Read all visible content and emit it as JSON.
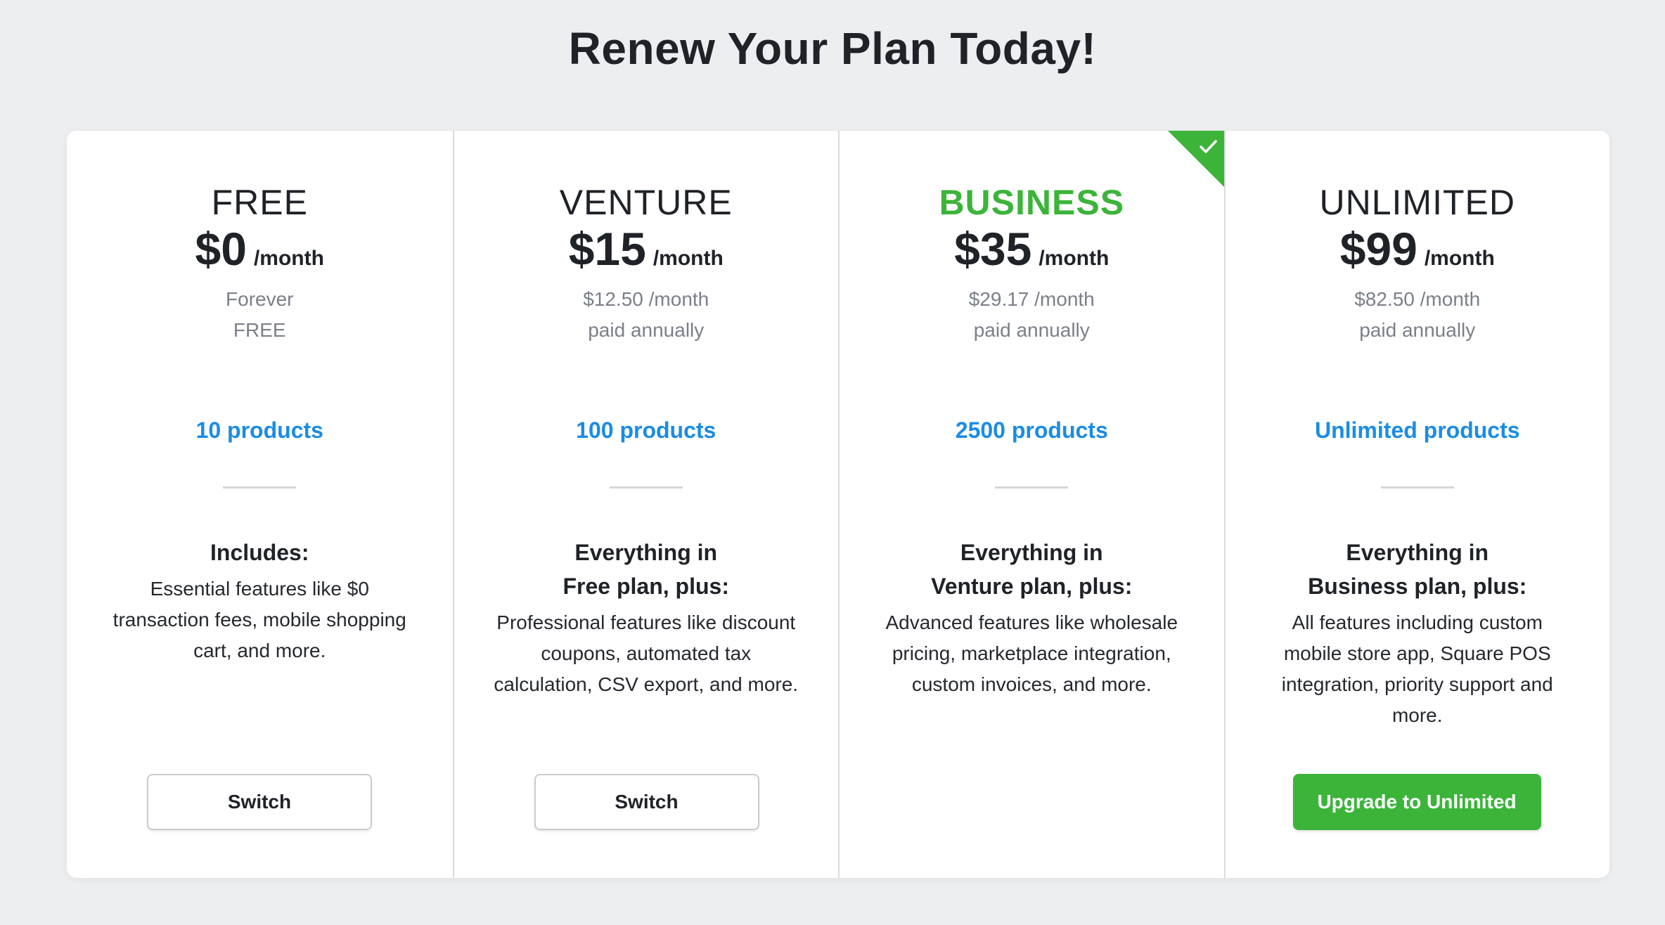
{
  "page": {
    "title": "Renew Your Plan Today!"
  },
  "colors": {
    "accent_green": "#3cb43a",
    "link_blue": "#1a8ce6",
    "muted_text": "#7b8088"
  },
  "plans": [
    {
      "name": "FREE",
      "price": "$0",
      "per": "/month",
      "sub_line1": "Forever",
      "sub_line2": "FREE",
      "products": "10 products",
      "heading_line1": "Includes:",
      "heading_line2": "",
      "description": [
        "Essential features like $0",
        "transaction fees, mobile shopping",
        "cart, and more."
      ],
      "button_label": "Switch"
    },
    {
      "name": "VENTURE",
      "price": "$15",
      "per": "/month",
      "sub_line1": "$12.50 /month",
      "sub_line2": "paid annually",
      "products": "100 products",
      "heading_line1": "Everything in",
      "heading_line2": "Free plan, plus:",
      "description": [
        "Professional features like discount",
        "coupons, automated tax",
        "calculation, CSV export, and more."
      ],
      "button_label": "Switch"
    },
    {
      "name": "BUSINESS",
      "price": "$35",
      "per": "/month",
      "sub_line1": "$29.17 /month",
      "sub_line2": "paid annually",
      "products": "2500 products",
      "heading_line1": "Everything in",
      "heading_line2": "Venture plan, plus:",
      "description": [
        "Advanced features like wholesale",
        "pricing, marketplace integration,",
        "custom invoices, and more."
      ],
      "current_plan_icon": "check-icon"
    },
    {
      "name": "UNLIMITED",
      "price": "$99",
      "per": "/month",
      "sub_line1": "$82.50 /month",
      "sub_line2": "paid annually",
      "products": "Unlimited products",
      "heading_line1": "Everything in",
      "heading_line2": "Business plan, plus:",
      "description": [
        "All features including custom",
        "mobile store app, Square POS",
        "integration, priority support and",
        "more."
      ],
      "button_label": "Upgrade to Unlimited"
    }
  ]
}
